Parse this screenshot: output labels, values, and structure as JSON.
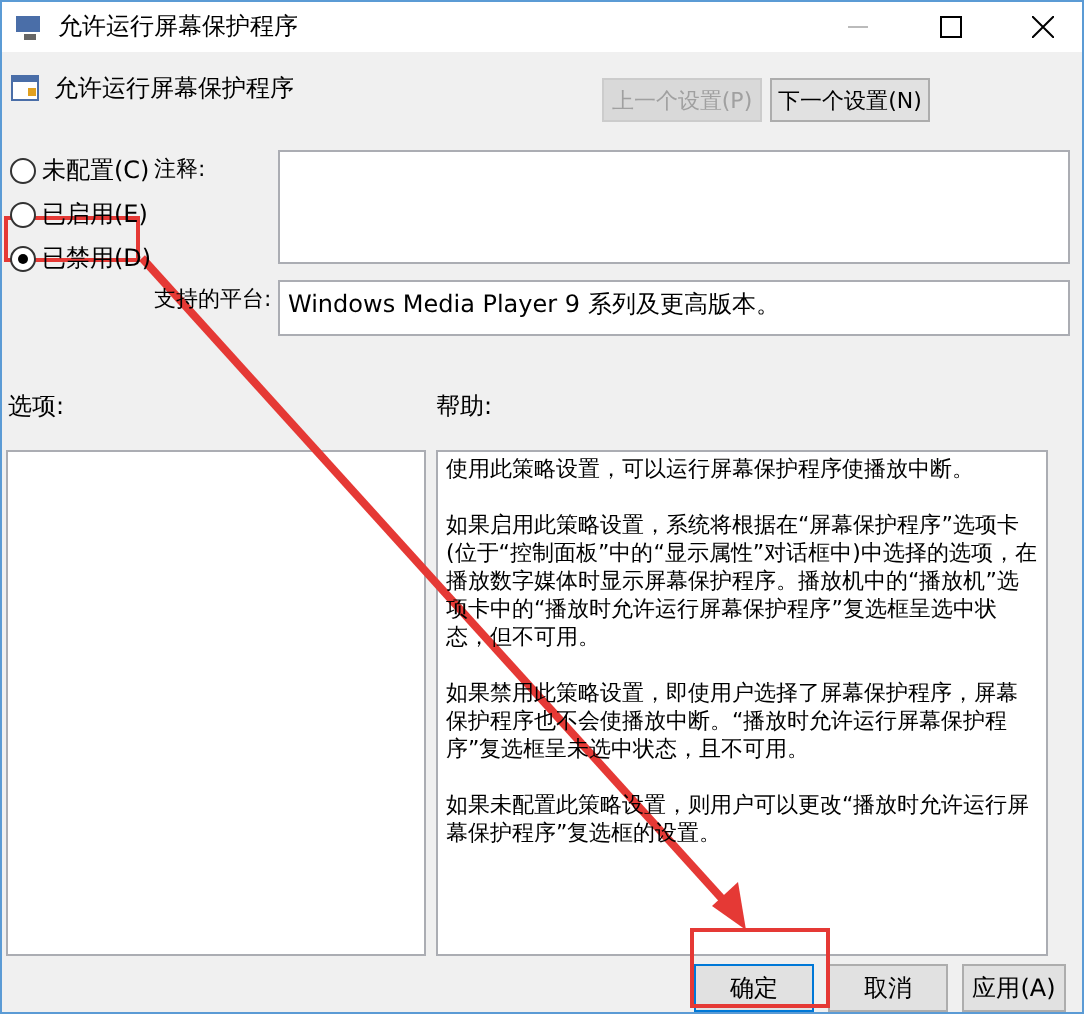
{
  "window": {
    "title": "允许运行屏幕保护程序"
  },
  "header": {
    "title": "允许运行屏幕保护程序"
  },
  "nav_buttons": [
    {
      "label": "上一个设置(P)",
      "disabled": true
    },
    {
      "label": "下一个设置(N)",
      "disabled": false
    }
  ],
  "radios": [
    {
      "label": "未配置(C)",
      "selected": false
    },
    {
      "label": "已启用(E)",
      "selected": false
    },
    {
      "label": "已禁用(D)",
      "selected": true
    }
  ],
  "comment": {
    "label": "注释:"
  },
  "platform": {
    "label": "支持的平台:",
    "value": "Windows Media Player 9 系列及更高版本。"
  },
  "options": {
    "label": "选项:"
  },
  "help": {
    "label": "帮助:",
    "paragraphs": [
      "使用此策略设置，可以运行屏幕保护程序使播放中断。",
      "如果启用此策略设置，系统将根据在“屏幕保护程序”选项卡(位于“控制面板”中的“显示属性”对话框中)中选择的选项，在播放数字媒体时显示屏幕保护程序。播放机中的“播放机”选项卡中的“播放时允许运行屏幕保护程序”复选框呈选中状态，但不可用。",
      "如果禁用此策略设置，即使用户选择了屏幕保护程序，屏幕保护程序也不会使播放中断。“播放时允许运行屏幕保护程序”复选框呈未选中状态，且不可用。",
      "如果未配置此策略设置，则用户可以更改“播放时允许运行屏幕保护程序”复选框的设置。"
    ]
  },
  "footer_buttons": [
    {
      "label": "确定",
      "default": true
    },
    {
      "label": "取消",
      "default": false
    },
    {
      "label": "应用(A)",
      "default": false
    }
  ]
}
